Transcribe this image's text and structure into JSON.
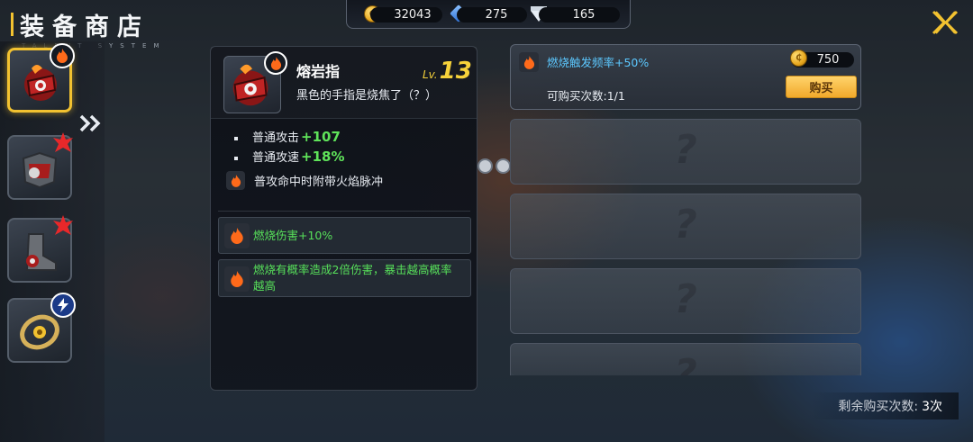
{
  "header": {
    "title": "装备商店",
    "subtitle": "TALENT  SYSTEM"
  },
  "currencies": [
    {
      "icon": "coin-icon",
      "value": "32043"
    },
    {
      "icon": "blue-gem-icon",
      "value": "275"
    },
    {
      "icon": "diamond-icon",
      "value": "165"
    }
  ],
  "sidebar": {
    "items": [
      {
        "name": "熔岩指",
        "badge": "fire-icon",
        "active": true
      },
      {
        "name": "armor",
        "badge": "fire-icon",
        "active": false
      },
      {
        "name": "boots",
        "badge": "fire-icon",
        "active": false
      },
      {
        "name": "amulet",
        "badge": "lightning-icon",
        "active": false
      }
    ]
  },
  "detail": {
    "name": "熔岩指",
    "level_label": "Lv.",
    "level": "13",
    "description": "黑色的手指是烧焦了（？）",
    "stats": [
      {
        "label": "普通攻击",
        "value": "+107"
      },
      {
        "label": "普通攻速",
        "value": "+18%"
      }
    ],
    "effect": "普攻命中时附带火焰脉冲",
    "bonuses": [
      {
        "text": "燃烧伤害+10%"
      },
      {
        "text": "燃烧有概率造成2倍伤害，暴击越高概率越高"
      }
    ]
  },
  "shop": {
    "offer": {
      "name": "燃烧触发频率+50%",
      "count_label": "可购买次数:1/1",
      "price": "750",
      "buy_label": "购买"
    },
    "locked_placeholder": "?",
    "remaining_label": "剩余购买次数:",
    "remaining_value": "3次"
  },
  "colors": {
    "accent_gold": "#f2c230",
    "stat_green": "#5fe35a",
    "offer_blue": "#5cc8ff"
  }
}
